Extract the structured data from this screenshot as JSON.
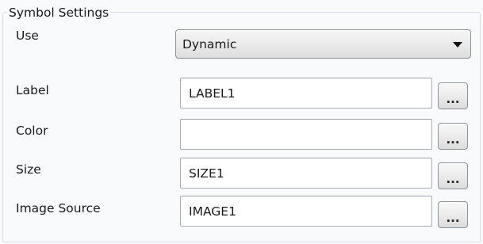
{
  "group": {
    "title": "Symbol Settings"
  },
  "use": {
    "label": "Use",
    "value": "Dynamic"
  },
  "rows": [
    {
      "label": "Label",
      "value": "LABEL1",
      "browse_label": "..."
    },
    {
      "label": "Color",
      "value": "",
      "browse_label": "..."
    },
    {
      "label": "Size",
      "value": "SIZE1",
      "browse_label": "..."
    },
    {
      "label": "Image Source",
      "value": "IMAGE1",
      "browse_label": "..."
    }
  ]
}
